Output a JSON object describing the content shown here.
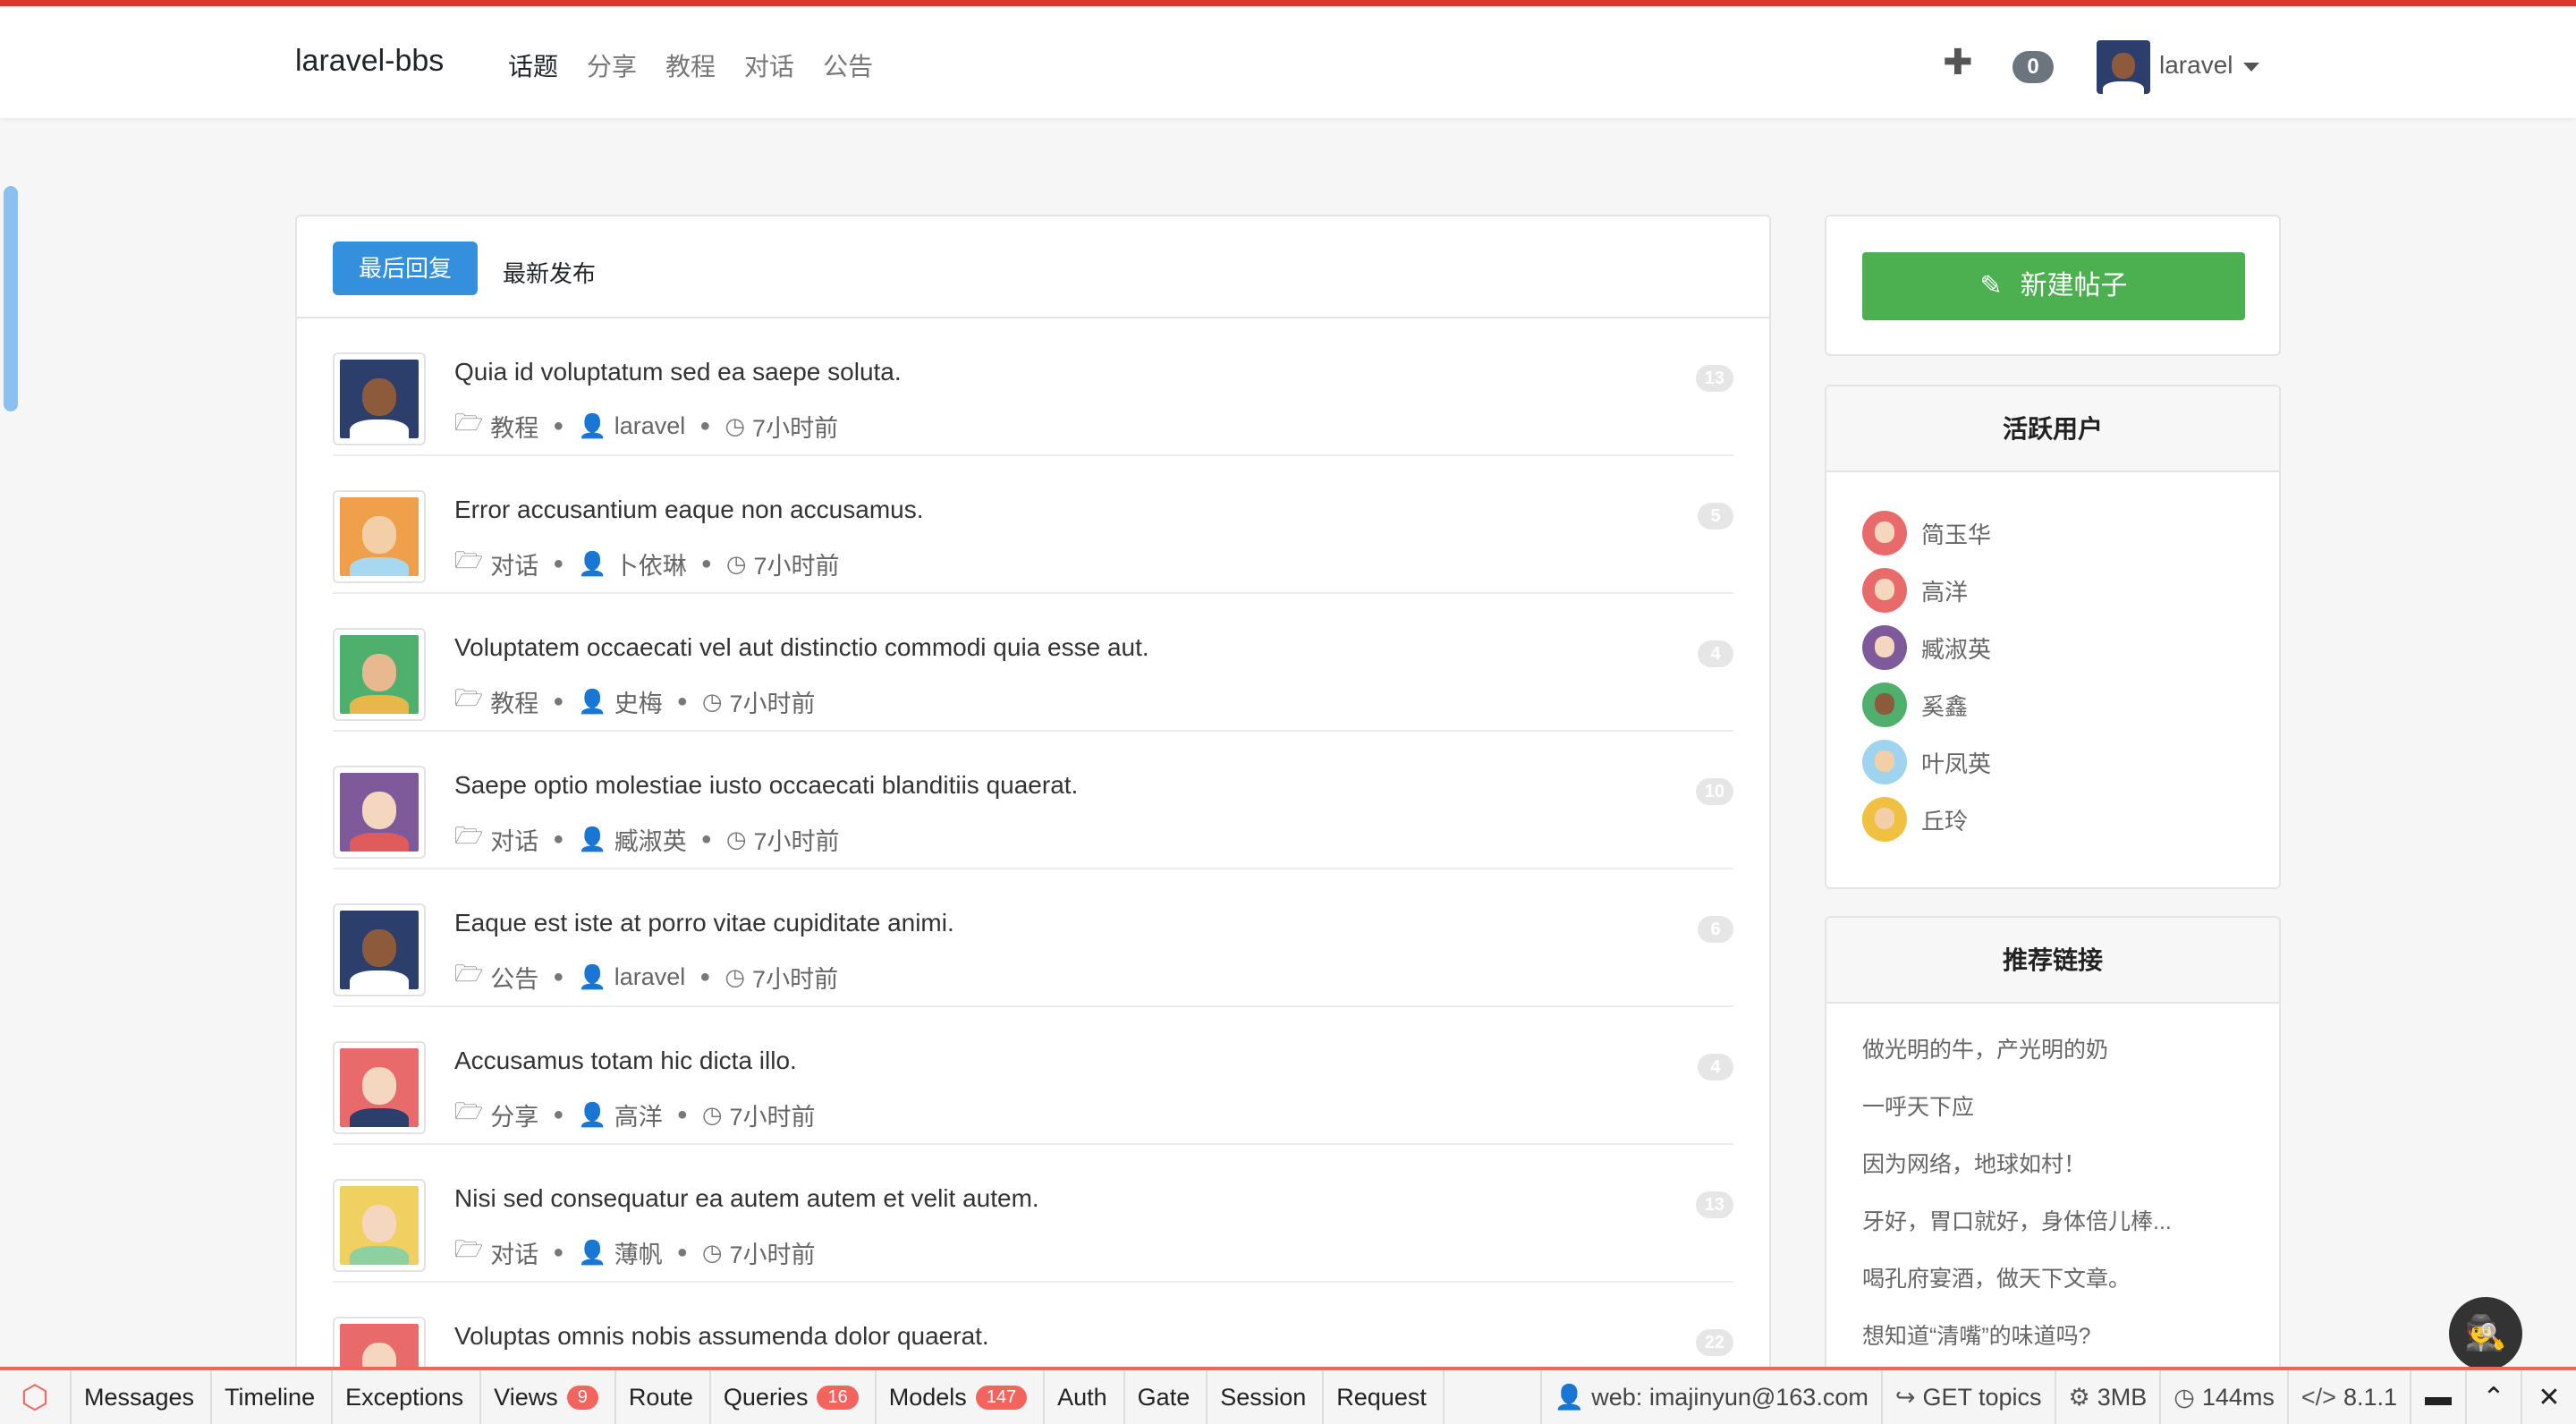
{
  "colors": {
    "accent": "#e3342f",
    "primary": "#3490dc",
    "success": "#4caf50",
    "debug": "#f4645f"
  },
  "navbar": {
    "brand": "laravel-bbs",
    "items": [
      "话题",
      "分享",
      "教程",
      "对话",
      "公告"
    ],
    "plus": "✚",
    "notifications": "0",
    "user": "laravel"
  },
  "tabs": {
    "active": "最后回复",
    "other": "最新发布"
  },
  "topics": [
    {
      "title": "Quia id voluptatum sed ea saepe soluta.",
      "category": "教程",
      "author": "laravel",
      "time": "7小时前",
      "replies": "13",
      "avatar_bg": "#2c3e6b",
      "face": "#8d5a3b",
      "shirt": "#ffffff"
    },
    {
      "title": "Error accusantium eaque non accusamus.",
      "category": "对话",
      "author": "卜依琳",
      "time": "7小时前",
      "replies": "5",
      "avatar_bg": "#f0a04b",
      "face": "#f3cfa8",
      "shirt": "#a8d8f0"
    },
    {
      "title": "Voluptatem occaecati vel aut distinctio commodi quia esse aut.",
      "category": "教程",
      "author": "史梅",
      "time": "7小时前",
      "replies": "4",
      "avatar_bg": "#4fb06e",
      "face": "#e8b890",
      "shirt": "#e6b84a"
    },
    {
      "title": "Saepe optio molestiae iusto occaecati blanditiis quaerat.",
      "category": "对话",
      "author": "臧淑英",
      "time": "7小时前",
      "replies": "10",
      "avatar_bg": "#7e5a9b",
      "face": "#f5d7c0",
      "shirt": "#e05b5b"
    },
    {
      "title": "Eaque est iste at porro vitae cupiditate animi.",
      "category": "公告",
      "author": "laravel",
      "time": "7小时前",
      "replies": "6",
      "avatar_bg": "#2c3e6b",
      "face": "#8d5a3b",
      "shirt": "#ffffff"
    },
    {
      "title": "Accusamus totam hic dicta illo.",
      "category": "分享",
      "author": "高洋",
      "time": "7小时前",
      "replies": "4",
      "avatar_bg": "#e86a6a",
      "face": "#f5d7c0",
      "shirt": "#2c3e6b"
    },
    {
      "title": "Nisi sed consequatur ea autem autem et velit autem.",
      "category": "对话",
      "author": "薄帆",
      "time": "7小时前",
      "replies": "13",
      "avatar_bg": "#f0d060",
      "face": "#f5d7c0",
      "shirt": "#8fd0a0"
    },
    {
      "title": "Voluptas omnis nobis assumenda dolor quaerat.",
      "category": "",
      "author": "",
      "time": "",
      "replies": "22",
      "avatar_bg": "#e86a6a",
      "face": "#f5d7c0",
      "shirt": "#2c3e6b"
    }
  ],
  "sidebar": {
    "new_post": "新建帖子",
    "active_users_title": "活跃用户",
    "active_users": [
      {
        "name": "简玉华",
        "bg": "#e86a6a",
        "face": "#f5d7c0"
      },
      {
        "name": "高洋",
        "bg": "#e86a6a",
        "face": "#f5d7c0"
      },
      {
        "name": "臧淑英",
        "bg": "#7e5a9b",
        "face": "#f5d7c0"
      },
      {
        "name": "奚鑫",
        "bg": "#4fb06e",
        "face": "#8d5a3b"
      },
      {
        "name": "叶凤英",
        "bg": "#9fd4f0",
        "face": "#f3cfa8"
      },
      {
        "name": "丘玲",
        "bg": "#f0c040",
        "face": "#f3cfa8"
      }
    ],
    "links_title": "推荐链接",
    "links": [
      "做光明的牛，产光明的奶",
      "一呼天下应",
      "因为网络，地球如村！",
      "牙好，胃口就好，身体倍儿棒...",
      "喝孔府宴酒，做天下文章。",
      "想知道“清嘴”的味道吗?"
    ]
  },
  "debugbar": {
    "tabs": [
      {
        "label": "Messages",
        "count": ""
      },
      {
        "label": "Timeline",
        "count": ""
      },
      {
        "label": "Exceptions",
        "count": ""
      },
      {
        "label": "Views",
        "count": "9"
      },
      {
        "label": "Route",
        "count": ""
      },
      {
        "label": "Queries",
        "count": "16"
      },
      {
        "label": "Models",
        "count": "147"
      },
      {
        "label": "Auth",
        "count": ""
      },
      {
        "label": "Gate",
        "count": ""
      },
      {
        "label": "Session",
        "count": ""
      },
      {
        "label": "Request",
        "count": ""
      }
    ],
    "user": "web: imajinyun@163.com",
    "route": "GET topics",
    "memory": "3MB",
    "time": "144ms",
    "php": "8.1.1"
  }
}
